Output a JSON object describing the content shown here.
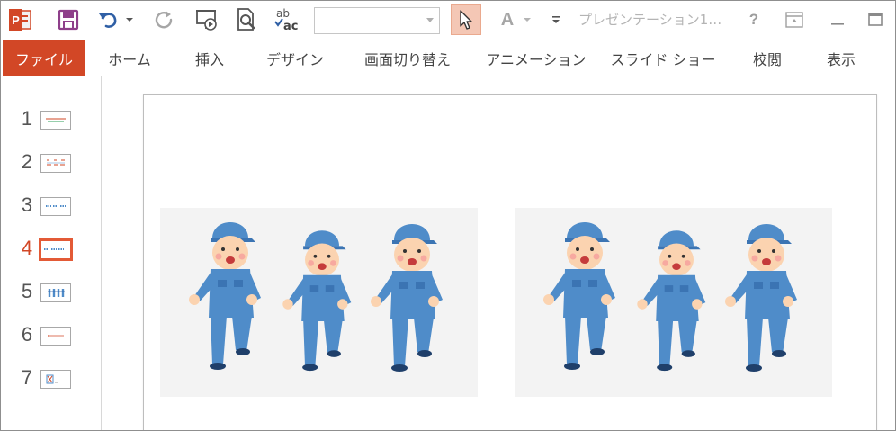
{
  "app": {
    "doc_title": "プレゼンテーション1…",
    "icons": [
      "powerpoint-icon",
      "save-icon",
      "undo-icon",
      "redo-icon",
      "present-icon",
      "print-preview-icon",
      "spelling-icon",
      "pointer-icon",
      "font-color-icon"
    ],
    "colors": {
      "accent": "#d24726",
      "select_highlight": "#f4c7b5",
      "worker_blue": "#4f8cc9"
    }
  },
  "toolbar": {
    "spell_top": "ab",
    "spell_bottom": "ac",
    "font_color_letter": "A",
    "help_label": "?"
  },
  "tabs": [
    {
      "label": "ファイル"
    },
    {
      "label": "ホーム"
    },
    {
      "label": "挿入"
    },
    {
      "label": "デザイン"
    },
    {
      "label": "画面切り替え"
    },
    {
      "label": "アニメーション"
    },
    {
      "label": "スライド ショー"
    },
    {
      "label": "校閲"
    },
    {
      "label": "表示"
    }
  ],
  "slides": [
    {
      "number": "1"
    },
    {
      "number": "2"
    },
    {
      "number": "3"
    },
    {
      "number": "4",
      "selected": true
    },
    {
      "number": "5"
    },
    {
      "number": "6"
    },
    {
      "number": "7"
    }
  ],
  "canvas": {
    "pictures": [
      {
        "content": "three workers in blue uniforms running"
      },
      {
        "content": "three workers in blue uniforms running"
      }
    ]
  }
}
